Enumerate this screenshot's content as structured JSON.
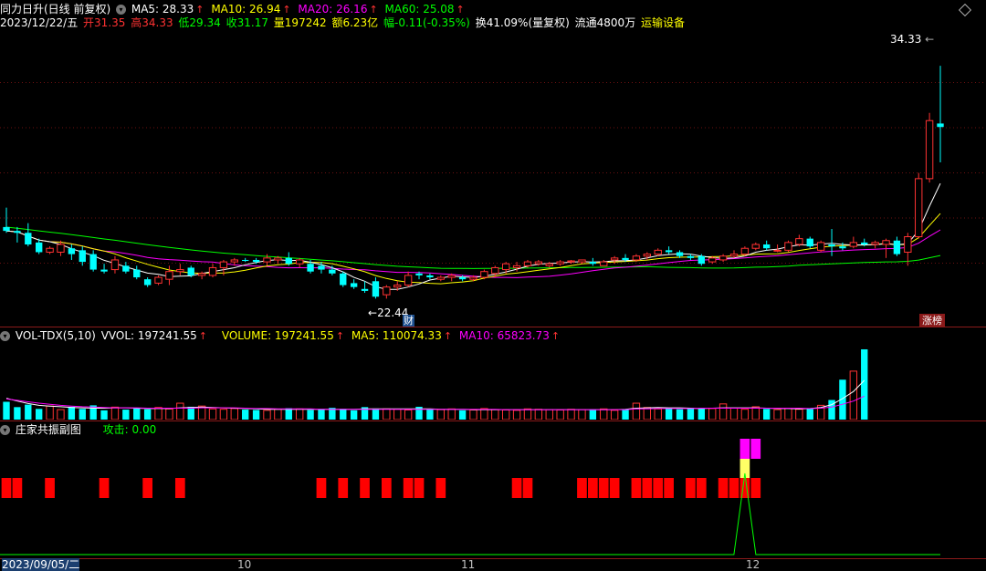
{
  "header": {
    "stock_title": "同力日升(日线 前复权)",
    "ma5": "MA5: 28.33",
    "ma10": "MA10: 26.94",
    "ma20": "MA20: 26.16",
    "ma60": "MA60: 25.08",
    "date": "2023/12/22/五",
    "open": "开31.35",
    "high": "高34.33",
    "low": "低29.34",
    "close": "收31.17",
    "volume": "量197242",
    "amount": "额6.23亿",
    "change": "幅-0.11(-0.35%)",
    "turnover": "换41.09%(量复权)",
    "float": "流通4800万",
    "sector": "运输设备"
  },
  "volume_panel": {
    "title": "VOL-TDX(5,10)",
    "vvol": "VVOL: 197241.55",
    "volume": "VOLUME: 197241.55",
    "ma5": "MA5: 110074.33",
    "ma10": "MA10: 65823.73"
  },
  "indicator_panel": {
    "title": "庄家共振副图",
    "attack": "攻击: 0.00"
  },
  "annotations": {
    "high_label": "34.33",
    "low_label": "22.44",
    "cai_badge": "财",
    "zhangbang_badge": "涨榜"
  },
  "x_axis": {
    "start_date": "2023/09/05/二",
    "month_10": "10",
    "month_11": "11",
    "month_12": "12"
  },
  "colors": {
    "up": "#ff3232",
    "down": "#00ffff",
    "ma5": "#ffffff",
    "ma10": "#ffff00",
    "ma20": "#ff00ff",
    "ma60": "#00ff00",
    "volume_label": "#ffff00"
  },
  "chart_data": {
    "type": "candlestick",
    "ylim": [
      21.8,
      35.8
    ],
    "candles": [
      {
        "o": 26.0,
        "h": 27.0,
        "l": 25.7,
        "c": 25.8
      },
      {
        "o": 25.8,
        "h": 26.0,
        "l": 25.2,
        "c": 25.7
      },
      {
        "o": 25.7,
        "h": 26.2,
        "l": 25.0,
        "c": 25.1
      },
      {
        "o": 25.2,
        "h": 25.4,
        "l": 24.6,
        "c": 24.7
      },
      {
        "o": 24.7,
        "h": 25.0,
        "l": 24.6,
        "c": 24.9
      },
      {
        "o": 24.7,
        "h": 25.3,
        "l": 24.5,
        "c": 25.1
      },
      {
        "o": 24.9,
        "h": 25.1,
        "l": 24.3,
        "c": 24.6
      },
      {
        "o": 24.8,
        "h": 25.0,
        "l": 24.0,
        "c": 24.2
      },
      {
        "o": 24.6,
        "h": 24.8,
        "l": 23.7,
        "c": 23.8
      },
      {
        "o": 23.8,
        "h": 24.1,
        "l": 23.6,
        "c": 23.7
      },
      {
        "o": 23.8,
        "h": 24.5,
        "l": 23.6,
        "c": 24.3
      },
      {
        "o": 24.0,
        "h": 24.2,
        "l": 23.6,
        "c": 23.7
      },
      {
        "o": 23.8,
        "h": 24.0,
        "l": 23.3,
        "c": 23.4
      },
      {
        "o": 23.3,
        "h": 23.4,
        "l": 22.9,
        "c": 23.0
      },
      {
        "o": 23.1,
        "h": 23.5,
        "l": 23.0,
        "c": 23.4
      },
      {
        "o": 23.3,
        "h": 24.0,
        "l": 23.0,
        "c": 23.7
      },
      {
        "o": 23.7,
        "h": 24.1,
        "l": 23.5,
        "c": 23.8
      },
      {
        "o": 23.9,
        "h": 24.0,
        "l": 23.4,
        "c": 23.5
      },
      {
        "o": 23.5,
        "h": 23.7,
        "l": 23.3,
        "c": 23.6
      },
      {
        "o": 23.5,
        "h": 24.1,
        "l": 23.4,
        "c": 23.9
      },
      {
        "o": 23.9,
        "h": 24.3,
        "l": 23.5,
        "c": 24.2
      },
      {
        "o": 24.2,
        "h": 24.4,
        "l": 24.0,
        "c": 24.3
      },
      {
        "o": 24.3,
        "h": 24.4,
        "l": 24.2,
        "c": 24.25
      },
      {
        "o": 24.3,
        "h": 24.4,
        "l": 24.1,
        "c": 24.2
      },
      {
        "o": 24.2,
        "h": 24.6,
        "l": 24.0,
        "c": 24.4
      },
      {
        "o": 24.3,
        "h": 24.5,
        "l": 24.1,
        "c": 24.4
      },
      {
        "o": 24.4,
        "h": 24.7,
        "l": 24.0,
        "c": 24.1
      },
      {
        "o": 24.1,
        "h": 24.4,
        "l": 23.9,
        "c": 24.3
      },
      {
        "o": 24.1,
        "h": 24.3,
        "l": 23.6,
        "c": 23.7
      },
      {
        "o": 24.0,
        "h": 24.2,
        "l": 23.6,
        "c": 23.8
      },
      {
        "o": 23.8,
        "h": 24.0,
        "l": 23.5,
        "c": 23.6
      },
      {
        "o": 23.6,
        "h": 23.7,
        "l": 22.9,
        "c": 23.0
      },
      {
        "o": 23.1,
        "h": 23.3,
        "l": 22.8,
        "c": 22.9
      },
      {
        "o": 22.8,
        "h": 23.2,
        "l": 22.6,
        "c": 22.7
      },
      {
        "o": 23.2,
        "h": 23.4,
        "l": 22.3,
        "c": 22.4
      },
      {
        "o": 22.5,
        "h": 23.0,
        "l": 22.3,
        "c": 22.9
      },
      {
        "o": 22.9,
        "h": 23.2,
        "l": 22.7,
        "c": 23.0
      },
      {
        "o": 23.0,
        "h": 23.7,
        "l": 22.9,
        "c": 23.5
      },
      {
        "o": 23.6,
        "h": 23.7,
        "l": 23.3,
        "c": 23.5
      },
      {
        "o": 23.5,
        "h": 23.6,
        "l": 23.3,
        "c": 23.4
      },
      {
        "o": 23.3,
        "h": 23.5,
        "l": 23.2,
        "c": 23.4
      },
      {
        "o": 23.4,
        "h": 23.6,
        "l": 23.2,
        "c": 23.5
      },
      {
        "o": 23.4,
        "h": 23.5,
        "l": 23.2,
        "c": 23.3
      },
      {
        "o": 23.3,
        "h": 23.5,
        "l": 23.2,
        "c": 23.4
      },
      {
        "o": 23.4,
        "h": 23.8,
        "l": 23.3,
        "c": 23.7
      },
      {
        "o": 23.6,
        "h": 24.0,
        "l": 23.4,
        "c": 23.9
      },
      {
        "o": 23.8,
        "h": 24.2,
        "l": 23.6,
        "c": 24.1
      },
      {
        "o": 23.9,
        "h": 24.2,
        "l": 23.7,
        "c": 24.0
      },
      {
        "o": 24.0,
        "h": 24.3,
        "l": 23.9,
        "c": 24.2
      },
      {
        "o": 24.1,
        "h": 24.3,
        "l": 24.0,
        "c": 24.2
      },
      {
        "o": 24.0,
        "h": 24.2,
        "l": 23.9,
        "c": 24.1
      },
      {
        "o": 24.1,
        "h": 24.3,
        "l": 24.0,
        "c": 24.2
      },
      {
        "o": 24.2,
        "h": 24.3,
        "l": 24.1,
        "c": 24.25
      },
      {
        "o": 24.2,
        "h": 24.3,
        "l": 24.1,
        "c": 24.3
      },
      {
        "o": 24.2,
        "h": 24.4,
        "l": 24.0,
        "c": 24.1
      },
      {
        "o": 24.0,
        "h": 24.3,
        "l": 24.0,
        "c": 24.2
      },
      {
        "o": 24.3,
        "h": 24.5,
        "l": 24.1,
        "c": 24.4
      },
      {
        "o": 24.4,
        "h": 24.6,
        "l": 24.2,
        "c": 24.3
      },
      {
        "o": 24.3,
        "h": 24.6,
        "l": 24.2,
        "c": 24.5
      },
      {
        "o": 24.5,
        "h": 24.7,
        "l": 24.3,
        "c": 24.6
      },
      {
        "o": 24.6,
        "h": 24.9,
        "l": 24.5,
        "c": 24.8
      },
      {
        "o": 24.8,
        "h": 25.0,
        "l": 24.6,
        "c": 24.7
      },
      {
        "o": 24.7,
        "h": 24.8,
        "l": 24.4,
        "c": 24.5
      },
      {
        "o": 24.5,
        "h": 24.6,
        "l": 24.3,
        "c": 24.4
      },
      {
        "o": 24.5,
        "h": 24.6,
        "l": 24.0,
        "c": 24.1
      },
      {
        "o": 24.2,
        "h": 24.5,
        "l": 24.1,
        "c": 24.4
      },
      {
        "o": 24.3,
        "h": 24.6,
        "l": 24.2,
        "c": 24.5
      },
      {
        "o": 24.5,
        "h": 24.8,
        "l": 24.4,
        "c": 24.6
      },
      {
        "o": 24.6,
        "h": 25.0,
        "l": 24.5,
        "c": 24.9
      },
      {
        "o": 24.9,
        "h": 25.2,
        "l": 24.8,
        "c": 25.1
      },
      {
        "o": 25.1,
        "h": 25.3,
        "l": 24.8,
        "c": 24.9
      },
      {
        "o": 24.8,
        "h": 25.1,
        "l": 24.7,
        "c": 24.8
      },
      {
        "o": 24.8,
        "h": 25.3,
        "l": 24.7,
        "c": 25.2
      },
      {
        "o": 25.1,
        "h": 25.6,
        "l": 25.0,
        "c": 25.4
      },
      {
        "o": 25.4,
        "h": 25.5,
        "l": 24.9,
        "c": 25.0
      },
      {
        "o": 24.8,
        "h": 25.3,
        "l": 24.7,
        "c": 25.2
      },
      {
        "o": 25.1,
        "h": 25.9,
        "l": 24.5,
        "c": 25.0
      },
      {
        "o": 25.0,
        "h": 25.2,
        "l": 24.8,
        "c": 24.9
      },
      {
        "o": 25.0,
        "h": 25.5,
        "l": 24.9,
        "c": 25.2
      },
      {
        "o": 25.2,
        "h": 25.4,
        "l": 25.0,
        "c": 25.1
      },
      {
        "o": 25.1,
        "h": 25.3,
        "l": 24.9,
        "c": 25.2
      },
      {
        "o": 25.1,
        "h": 25.4,
        "l": 24.4,
        "c": 25.3
      },
      {
        "o": 25.3,
        "h": 25.5,
        "l": 24.5,
        "c": 24.6
      },
      {
        "o": 24.7,
        "h": 25.7,
        "l": 24.0,
        "c": 25.5
      },
      {
        "o": 25.5,
        "h": 28.8,
        "l": 25.4,
        "c": 28.5
      },
      {
        "o": 28.5,
        "h": 31.9,
        "l": 28.3,
        "c": 31.5
      },
      {
        "o": 31.35,
        "h": 34.33,
        "l": 29.34,
        "c": 31.17
      }
    ],
    "volume": {
      "ylim": [
        0,
        210000
      ],
      "values": [
        50000,
        35000,
        42000,
        30000,
        38000,
        28000,
        36000,
        30000,
        40000,
        26000,
        35000,
        28000,
        31000,
        29000,
        34000,
        30000,
        46000,
        36000,
        38000,
        30000,
        29000,
        31000,
        28000,
        27000,
        26000,
        29000,
        32000,
        30000,
        27000,
        28000,
        33000,
        30000,
        26000,
        35000,
        31000,
        30000,
        29000,
        27000,
        36000,
        29000,
        28000,
        30000,
        26000,
        27000,
        31000,
        28000,
        27000,
        26000,
        30000,
        29000,
        28000,
        27000,
        29000,
        28000,
        27000,
        30000,
        26000,
        28000,
        46000,
        34000,
        30000,
        31000,
        29000,
        33000,
        30000,
        31000,
        44000,
        32000,
        29000,
        36000,
        30000,
        28000,
        32000,
        29000,
        30000,
        40000,
        55000,
        112000,
        136000,
        197242
      ],
      "ma5": [
        60000,
        52000,
        45000,
        40000,
        38000,
        36000,
        34000,
        33000,
        32000,
        32000,
        33000,
        33000,
        32000,
        31000,
        31000,
        31000,
        33000,
        34000,
        35000,
        34000,
        33000,
        32000,
        31000,
        30000,
        29000,
        29000,
        29000,
        29000,
        29000,
        29000,
        29000,
        29000,
        29000,
        30000,
        30000,
        30000,
        30000,
        30000,
        30000,
        30000,
        29000,
        29000,
        29000,
        28000,
        28000,
        28000,
        28000,
        28000,
        28000,
        28000,
        28000,
        28000,
        28000,
        28000,
        28000,
        28000,
        28000,
        29000,
        32000,
        33000,
        34000,
        33000,
        33000,
        32000,
        31000,
        32000,
        33000,
        33000,
        33000,
        33000,
        32000,
        31000,
        31000,
        30000,
        31000,
        34000,
        42000,
        59000,
        79000,
        110074
      ],
      "ma10": [
        58000,
        54000,
        50000,
        46000,
        43000,
        40000,
        38000,
        36000,
        35000,
        34000,
        33000,
        33000,
        33000,
        32000,
        32000,
        32000,
        32000,
        32000,
        33000,
        33000,
        33000,
        33000,
        32000,
        31000,
        31000,
        30000,
        30000,
        30000,
        30000,
        29000,
        29000,
        29000,
        29000,
        29000,
        29000,
        29000,
        29000,
        29000,
        29000,
        29000,
        29000,
        29000,
        29000,
        29000,
        29000,
        29000,
        28000,
        28000,
        28000,
        28000,
        28000,
        28000,
        28000,
        28000,
        28000,
        28000,
        28000,
        28000,
        30000,
        30000,
        31000,
        31000,
        31000,
        31000,
        32000,
        32000,
        32000,
        32000,
        32000,
        32000,
        32000,
        32000,
        32000,
        32000,
        31000,
        32000,
        35000,
        43000,
        52000,
        65824
      ]
    },
    "indicator": {
      "red_block_indices": [
        0,
        1,
        4,
        9,
        13,
        16,
        29,
        31,
        33,
        35,
        37,
        38,
        40,
        47,
        48,
        53,
        54,
        55,
        56,
        58,
        59,
        60,
        61,
        63,
        64,
        66,
        67,
        68,
        69
      ],
      "magenta_block_indices": [
        68,
        69
      ],
      "yellow_block_indices": [
        68
      ],
      "attack_peak_index": 68
    }
  }
}
